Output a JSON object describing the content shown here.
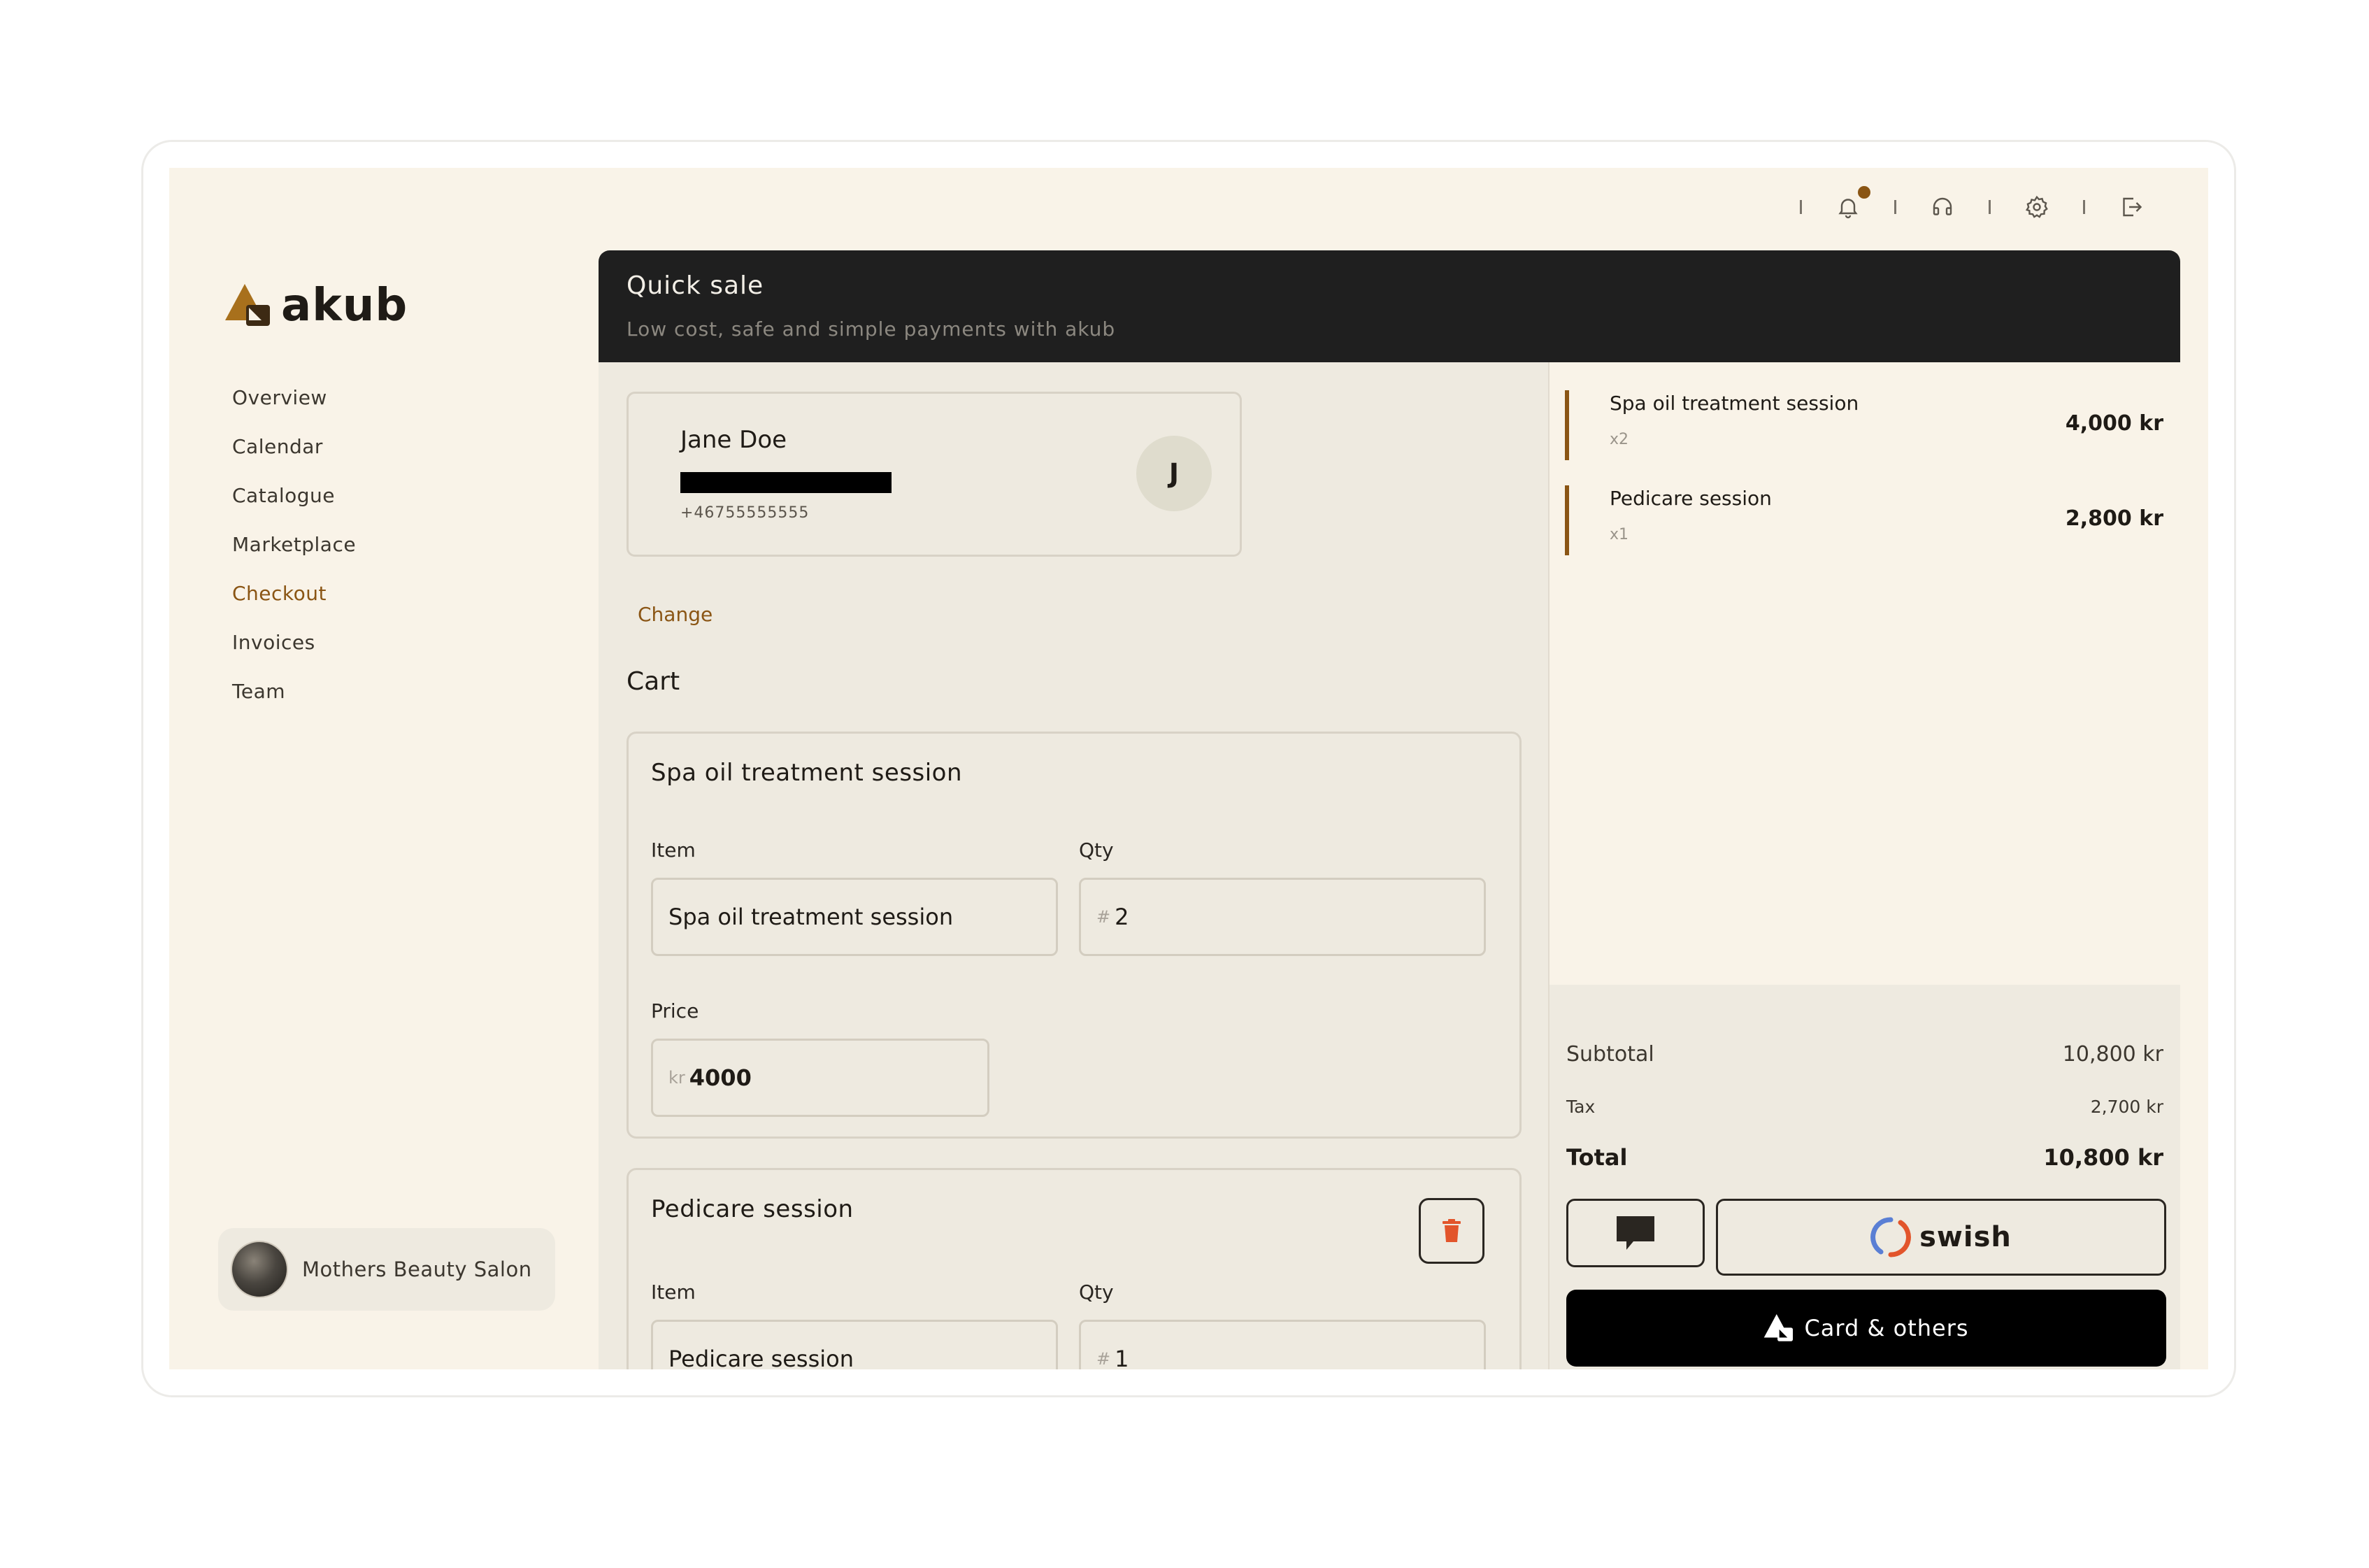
{
  "app": {
    "brand": "akub"
  },
  "sidebar": {
    "items": [
      {
        "label": "Overview"
      },
      {
        "label": "Calendar"
      },
      {
        "label": "Catalogue"
      },
      {
        "label": "Marketplace"
      },
      {
        "label": "Checkout",
        "active": true
      },
      {
        "label": "Invoices"
      },
      {
        "label": "Team"
      }
    ],
    "org_name": "Mothers Beauty Salon"
  },
  "topbar": {
    "icons": [
      "bell-icon",
      "headset-icon",
      "gear-icon",
      "logout-icon"
    ],
    "notification_dot_color": "#8a5514"
  },
  "header": {
    "title": "Quick sale",
    "subtitle": "Low cost, safe and simple payments with akub"
  },
  "customer": {
    "name": "Jane Doe",
    "phone": "+46755555555",
    "initial": "J",
    "change_label": "Change"
  },
  "cart": {
    "heading": "Cart",
    "items": [
      {
        "title": "Spa oil treatment session",
        "item_label": "Item",
        "item_value": "Spa oil treatment session",
        "qty_label": "Qty",
        "qty_prefix": "#",
        "qty_value": "2",
        "price_label": "Price",
        "price_prefix": "kr",
        "price_value": "4000"
      },
      {
        "title": "Pedicare session",
        "item_label": "Item",
        "item_value": "Pedicare session",
        "qty_label": "Qty",
        "qty_prefix": "#",
        "qty_value": "1"
      }
    ]
  },
  "summary": {
    "items": [
      {
        "name": "Spa oil treatment session",
        "qty": "x2",
        "price": "4,000 kr"
      },
      {
        "name": "Pedicare session",
        "qty": "x1",
        "price": "2,800 kr"
      }
    ],
    "subtotal_label": "Subtotal",
    "subtotal": "10,800 kr",
    "tax_label": "Tax",
    "tax": "2,700 kr",
    "total_label": "Total",
    "total": "10,800 kr",
    "swish_label": "swish",
    "card_label": "Card & others"
  },
  "colors": {
    "accent": "#8a5514",
    "background": "#f9f3e8",
    "panel": "#eeeae0",
    "header": "#1f1f1f",
    "danger": "#e2552b"
  }
}
